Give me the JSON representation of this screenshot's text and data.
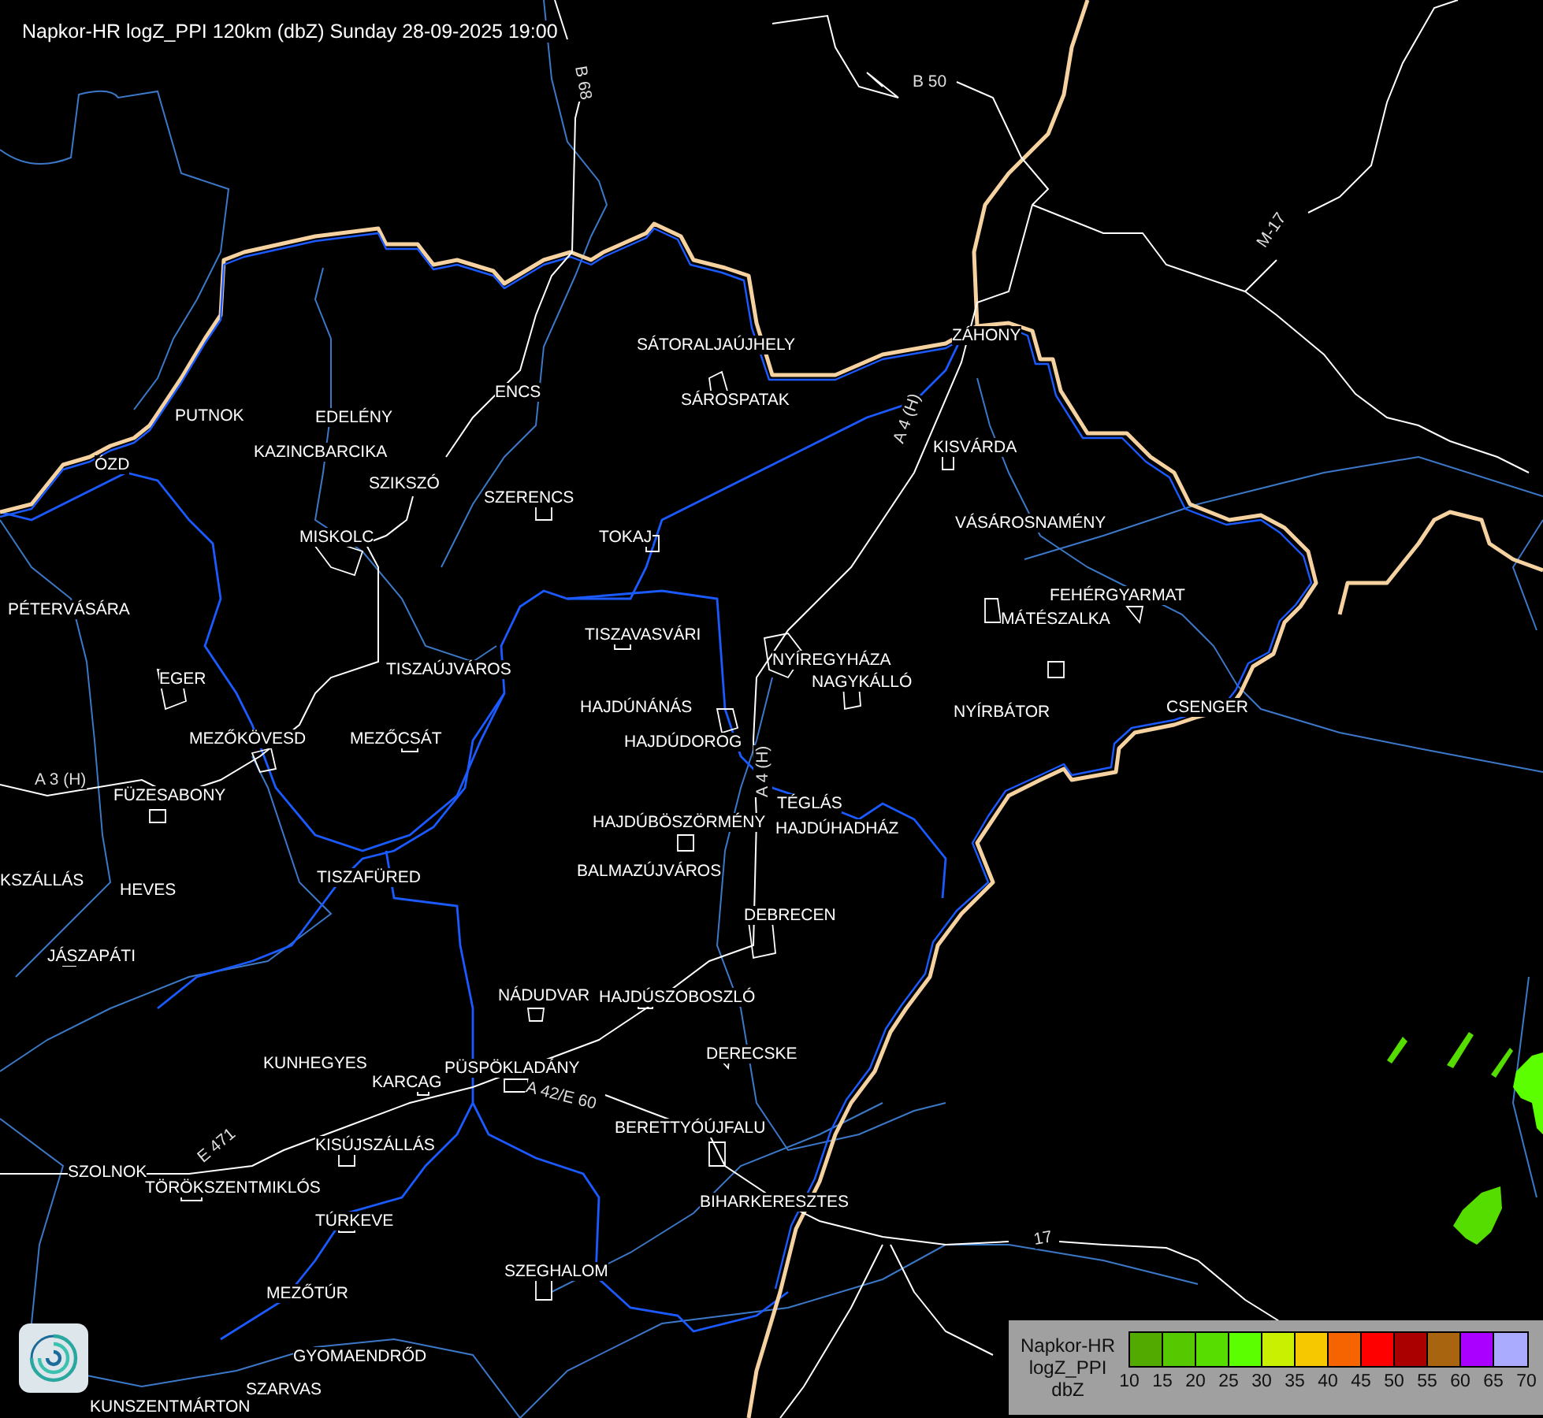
{
  "title": "Napkor-HR logZ_PPI 120km (dbZ) Sunday 28-09-2025 19:00",
  "labels": [
    {
      "text": "B 68",
      "kind": "road"
    },
    {
      "text": "B 50",
      "kind": "road"
    },
    {
      "text": "M-17",
      "kind": "road"
    },
    {
      "text": "SÁTORALJAÚJHELY",
      "kind": "city"
    },
    {
      "text": "ZÁHONY",
      "kind": "city"
    },
    {
      "text": "ENCS",
      "kind": "city"
    },
    {
      "text": "SÁROSPATAK",
      "kind": "city"
    },
    {
      "text": "PUTNOK",
      "kind": "city"
    },
    {
      "text": "EDELÉNY",
      "kind": "city"
    },
    {
      "text": "A 4 (H)",
      "kind": "road"
    },
    {
      "text": "KISVÁRDA",
      "kind": "city"
    },
    {
      "text": "KAZINCBARCIKA",
      "kind": "city"
    },
    {
      "text": "ÓZD",
      "kind": "city"
    },
    {
      "text": "SZIKSZÓ",
      "kind": "city"
    },
    {
      "text": "SZERENCS",
      "kind": "city"
    },
    {
      "text": "VÁSÁROSNAMÉNY",
      "kind": "city"
    },
    {
      "text": "MISKOLC",
      "kind": "city"
    },
    {
      "text": "TOKAJ",
      "kind": "city"
    },
    {
      "text": "FEHÉRGYARMAT",
      "kind": "city"
    },
    {
      "text": "PÉTERVÁSÁRA",
      "kind": "city"
    },
    {
      "text": "MÁTÉSZALKA",
      "kind": "city"
    },
    {
      "text": "TISZAVASVÁRI",
      "kind": "city"
    },
    {
      "text": "NYÍREGYHÁZA",
      "kind": "city"
    },
    {
      "text": "TISZAÚJVÁROS",
      "kind": "city"
    },
    {
      "text": "EGER",
      "kind": "city"
    },
    {
      "text": "NAGYKÁLLÓ",
      "kind": "city"
    },
    {
      "text": "HAJDÚNÁNÁS",
      "kind": "city"
    },
    {
      "text": "NYÍRBÁTOR",
      "kind": "city"
    },
    {
      "text": "CSENGER",
      "kind": "city"
    },
    {
      "text": "MEZŐKÖVESD",
      "kind": "city"
    },
    {
      "text": "MEZŐCSÁT",
      "kind": "city"
    },
    {
      "text": "HAJDÚDOROG",
      "kind": "city"
    },
    {
      "text": "A 4 (H)",
      "kind": "road"
    },
    {
      "text": "A 3 (H)",
      "kind": "road"
    },
    {
      "text": "FÜZESABONY",
      "kind": "city"
    },
    {
      "text": "TÉGLÁS",
      "kind": "city"
    },
    {
      "text": "HAJDÚBÖSZÖRMÉNY",
      "kind": "city"
    },
    {
      "text": "HAJDÚHADHÁZ",
      "kind": "city"
    },
    {
      "text": "BALMAZÚJVÁROS",
      "kind": "city"
    },
    {
      "text": "KSZÁLLÁS",
      "kind": "city"
    },
    {
      "text": "TISZAFÜRED",
      "kind": "city"
    },
    {
      "text": "HEVES",
      "kind": "city"
    },
    {
      "text": "DEBRECEN",
      "kind": "city"
    },
    {
      "text": "JÁSZAPÁTI",
      "kind": "city"
    },
    {
      "text": "NÁDUDVAR",
      "kind": "city"
    },
    {
      "text": "HAJDÚSZOBOSZLÓ",
      "kind": "city"
    },
    {
      "text": "DERECSKE",
      "kind": "city"
    },
    {
      "text": "KUNHEGYES",
      "kind": "city"
    },
    {
      "text": "PÜSPÖKLADÁNY",
      "kind": "city"
    },
    {
      "text": "KARCAG",
      "kind": "city"
    },
    {
      "text": "A 42/E 60",
      "kind": "road"
    },
    {
      "text": "BERETTYÓÚJFALU",
      "kind": "city"
    },
    {
      "text": "KISÚJSZÁLLÁS",
      "kind": "city"
    },
    {
      "text": "E 471",
      "kind": "road"
    },
    {
      "text": "SZOLNOK",
      "kind": "city"
    },
    {
      "text": "TÖRÖKSZENTMIKLÓS",
      "kind": "city"
    },
    {
      "text": "BIHARKERESZTES",
      "kind": "city"
    },
    {
      "text": "TÚRKEVE",
      "kind": "city"
    },
    {
      "text": "17",
      "kind": "road"
    },
    {
      "text": "SZEGHALOM",
      "kind": "city"
    },
    {
      "text": "MEZŐTÚR",
      "kind": "city"
    },
    {
      "text": "GYOMAENDRŐD",
      "kind": "city"
    },
    {
      "text": "SZARVAS",
      "kind": "city"
    },
    {
      "text": "KUNSZENTMÁRTON",
      "kind": "city"
    }
  ],
  "legend": {
    "title": [
      "Napkor-HR",
      "logZ_PPI",
      "dbZ"
    ],
    "bins": [
      {
        "color": "#52aa00"
      },
      {
        "color": "#55c800"
      },
      {
        "color": "#58dd00"
      },
      {
        "color": "#5cff00"
      },
      {
        "color": "#c8f000"
      },
      {
        "color": "#f5c800"
      },
      {
        "color": "#f56400"
      },
      {
        "color": "#ff0000"
      },
      {
        "color": "#aa0000"
      },
      {
        "color": "#a8640f"
      },
      {
        "color": "#aa00ff"
      },
      {
        "color": "#aaaaff"
      }
    ],
    "ticks": [
      "10",
      "15",
      "20",
      "25",
      "30",
      "35",
      "40",
      "45",
      "50",
      "55",
      "60",
      "65",
      "70"
    ]
  }
}
